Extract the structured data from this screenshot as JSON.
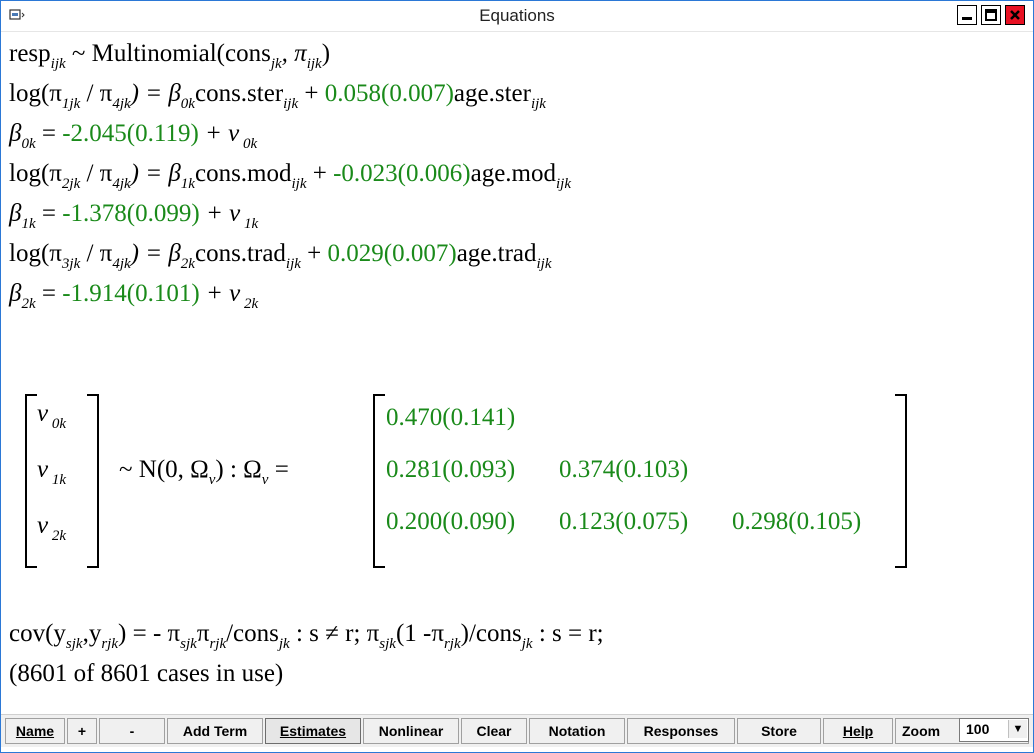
{
  "window": {
    "title": "Equations"
  },
  "equations": {
    "line1": {
      "a": "resp",
      "a_sub": "ijk",
      "b": " ~ Multinomial(cons",
      "b_sub": "jk",
      "c": ", π",
      "c_sub": "ijk",
      "d": ")"
    },
    "line2": {
      "a": "log(π",
      "a_sub": "1jk",
      "b": " / π",
      "b_sub": "4jk",
      "c": ") = β",
      "c_sub": "0k",
      "d": "cons.ster",
      "d_sub": "ijk",
      "e": " + ",
      "coef": "0.058(0.007)",
      "f": "age.ster",
      "f_sub": "ijk"
    },
    "line3": {
      "a": "β",
      "a_sub": "0k",
      "b": " = ",
      "coef": "-2.045(0.119)",
      "c": " + ν",
      "c_sub": " 0k"
    },
    "line4": {
      "a": "log(π",
      "a_sub": "2jk",
      "b": " / π",
      "b_sub": "4jk",
      "c": ") = β",
      "c_sub": "1k",
      "d": "cons.mod",
      "d_sub": "ijk",
      "e": " + ",
      "coef": "-0.023(0.006)",
      "f": "age.mod",
      "f_sub": "ijk"
    },
    "line5": {
      "a": "β",
      "a_sub": "1k",
      "b": " = ",
      "coef": "-1.378(0.099)",
      "c": " + ν",
      "c_sub": " 1k"
    },
    "line6": {
      "a": "log(π",
      "a_sub": "3jk",
      "b": " / π",
      "b_sub": "4jk",
      "c": ") = β",
      "c_sub": "2k",
      "d": "cons.trad",
      "d_sub": "ijk",
      "e": " + ",
      "coef": "0.029(0.007)",
      "f": "age.trad",
      "f_sub": "ijk"
    },
    "line7": {
      "a": "β",
      "a_sub": "2k",
      "b": " = ",
      "coef": "-1.914(0.101)",
      "c": " + ν",
      "c_sub": " 2k"
    }
  },
  "random": {
    "v0": "ν",
    "v0_sub": " 0k",
    "v1": "ν",
    "v1_sub": " 1k",
    "v2": "ν",
    "v2_sub": " 2k",
    "dist": "~ N(0,  Ω",
    "dist_sub": "ν",
    "dist_end": ")  :  Ω",
    "omega_sub": "ν",
    "omega_eq": " =",
    "row1": [
      "0.470(0.141)"
    ],
    "row2": [
      "0.281(0.093)",
      "0.374(0.103)"
    ],
    "row3": [
      "0.200(0.090)",
      "0.123(0.075)",
      "0.298(0.105)"
    ]
  },
  "cov_line": {
    "a": "cov(y",
    "a_sub": "sjk",
    "b": ",y",
    "b_sub": "rjk",
    "c": ") = -  π",
    "c_sub": "sjk",
    "d": "π",
    "d_sub": "rjk",
    "e": "/cons",
    "e_sub": "jk",
    "f": " : s ≠ r;    π",
    "f_sub": "sjk",
    "g": "(1 -π",
    "g_sub": "rjk",
    "h": ")/cons",
    "h_sub": "jk",
    "i": " : s = r;"
  },
  "cases": "(8601 of 8601 cases in use)",
  "toolbar": {
    "name": "Name",
    "plus": "+",
    "minus": "-",
    "add_term": "Add Term",
    "estimates": "Estimates",
    "nonlinear": "Nonlinear",
    "clear": "Clear",
    "notation": "Notation",
    "responses": "Responses",
    "store": "Store",
    "help": "Help",
    "zoom_label": "Zoom",
    "zoom_value": "100"
  },
  "colors": {
    "estimate": "#1a8a1a",
    "border": "#2b78d6",
    "close": "#e81123"
  }
}
